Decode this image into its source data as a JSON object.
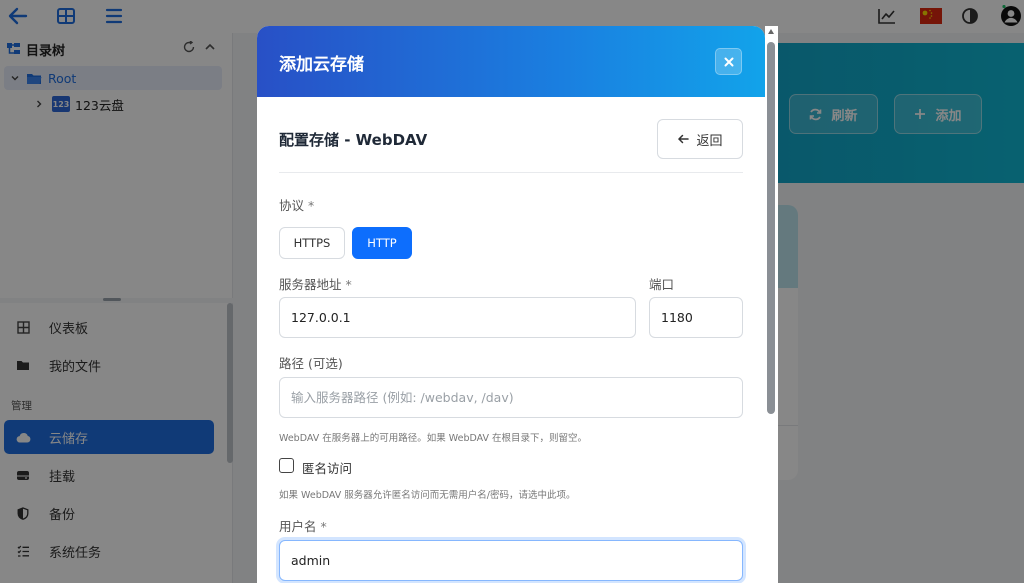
{
  "tree": {
    "title": "目录树",
    "root_label": "Root",
    "child_label": "123云盘",
    "child_badge": "123"
  },
  "nav": {
    "dashboard": "仪表板",
    "my_files": "我的文件",
    "group_manage": "管理",
    "cloud_storage": "云储存",
    "mount": "挂载",
    "backup": "备份",
    "tasks": "系统任务"
  },
  "hero": {
    "refresh_label": "刷新",
    "add_label": "添加"
  },
  "modal": {
    "title": "添加云存储",
    "section_title": "配置存储 - WebDAV",
    "back_label": "返回",
    "protocol_label": "协议",
    "required_mark": "*",
    "https_label": "HTTPS",
    "http_label": "HTTP",
    "server_label": "服务器地址",
    "server_value": "127.0.0.1",
    "port_label": "端口",
    "port_value": "1180",
    "path_label": "路径 (可选)",
    "path_placeholder": "输入服务器路径 (例如: /webdav, /dav)",
    "path_hint": "WebDAV 在服务器上的可用路径。如果 WebDAV 在根目录下，则留空。",
    "anon_label": "匿名访问",
    "anon_hint": "如果 WebDAV 服务器允许匿名访问而无需用户名/密码，请选中此项。",
    "username_label": "用户名",
    "username_value": "admin"
  },
  "colors": {
    "primary": "#0d6efd",
    "nav_active": "#1f6fe0",
    "header_gradient_start": "#2850c6",
    "header_gradient_end": "#12a3ea",
    "hero": "#11a6c9"
  }
}
